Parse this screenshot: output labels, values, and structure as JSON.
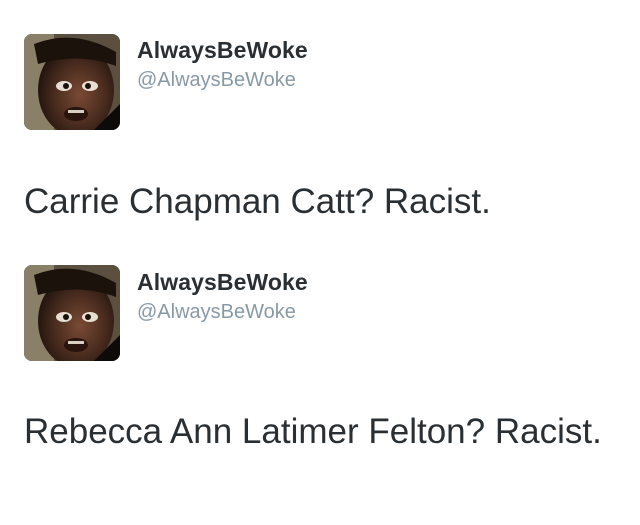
{
  "tweets": [
    {
      "display_name": "AlwaysBeWoke",
      "handle": "@AlwaysBeWoke",
      "avatar_icon": "profile-photo-avatar",
      "text": "Carrie Chapman Catt? Racist."
    },
    {
      "display_name": "AlwaysBeWoke",
      "handle": "@AlwaysBeWoke",
      "avatar_icon": "profile-photo-avatar",
      "text": "Rebecca Ann Latimer Felton? Racist."
    }
  ],
  "colors": {
    "name": "#292f33",
    "handle": "#8899a6",
    "text": "#292f33",
    "background": "#ffffff"
  }
}
